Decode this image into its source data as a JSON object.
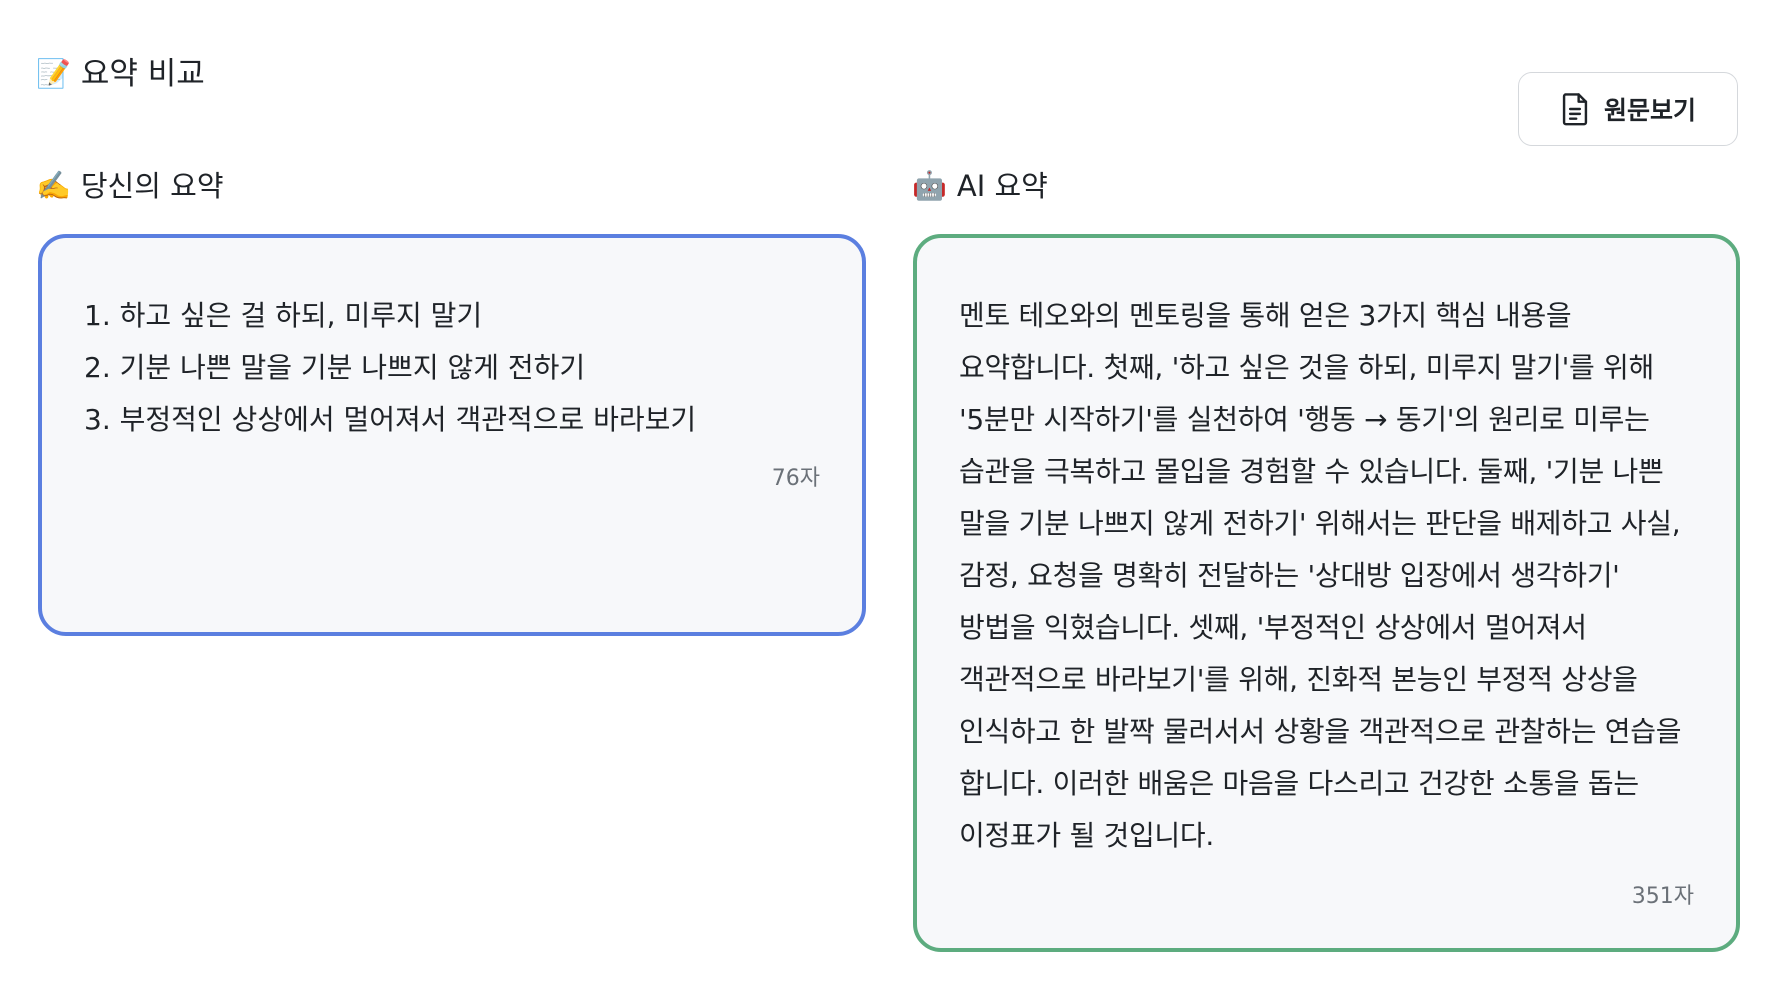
{
  "header": {
    "title_icon": "📝",
    "title": "요약 비교",
    "source_button_label": "원문보기",
    "source_button_icon": "document-icon"
  },
  "user_summary": {
    "label_icon": "✍️",
    "label": "당신의 요약",
    "items": [
      "1. 하고 싶은 걸 하되, 미루지 말기",
      "2. 기분 나쁜 말을 기분 나쁘지 않게 전하기",
      "3. 부정적인 상상에서 멀어져서 객관적으로 바라보기"
    ],
    "char_count": "76자",
    "border_color": "#5b7fe0"
  },
  "ai_summary": {
    "label_icon": "🤖",
    "label": "AI 요약",
    "text": "멘토 테오와의 멘토링을 통해 얻은 3가지 핵심 내용을 요약합니다. 첫째, '하고 싶은 것을 하되, 미루지 말기'를 위해 '5분만 시작하기'를 실천하여 '행동 → 동기'의 원리로 미루는 습관을 극복하고 몰입을 경험할 수 있습니다. 둘째, '기분 나쁜 말을 기분 나쁘지 않게 전하기' 위해서는 판단을 배제하고 사실, 감정, 요청을 명확히 전달하는 '상대방 입장에서 생각하기' 방법을 익혔습니다. 셋째, '부정적인 상상에서 멀어져서 객관적으로 바라보기'를 위해, 진화적 본능인 부정적 상상을 인식하고 한 발짝 물러서서 상황을 객관적으로 관찰하는 연습을 합니다. 이러한 배움은 마음을 다스리고 건강한 소통을 돕는 이정표가 될 것입니다.",
    "char_count": "351자",
    "border_color": "#5dac7f"
  }
}
